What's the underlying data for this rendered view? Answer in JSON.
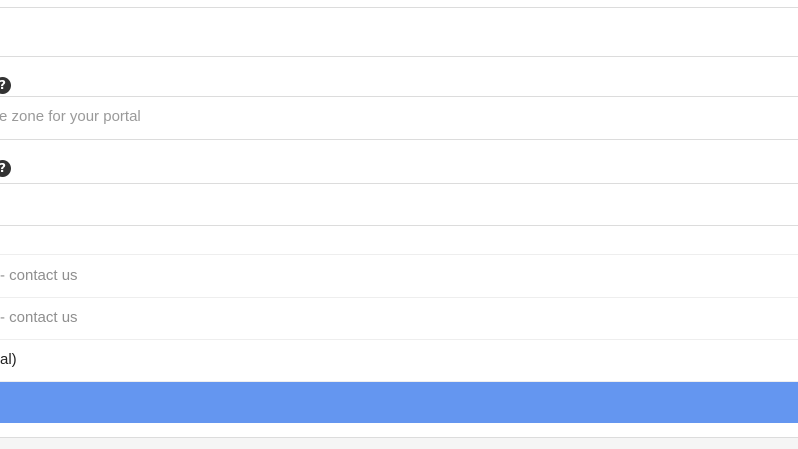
{
  "form": {
    "field1": {
      "value": ""
    },
    "timezone": {
      "help_icon": "question-circle-icon",
      "placeholder": "e zone for your portal"
    },
    "field3": {
      "help_icon": "question-circle-icon",
      "value": ""
    }
  },
  "options": [
    {
      "label": "- contact us"
    },
    {
      "label": " - contact us"
    },
    {
      "label": "al)"
    }
  ],
  "colors": {
    "accent_bar": "#6496f0",
    "border": "#dcdcdc"
  }
}
